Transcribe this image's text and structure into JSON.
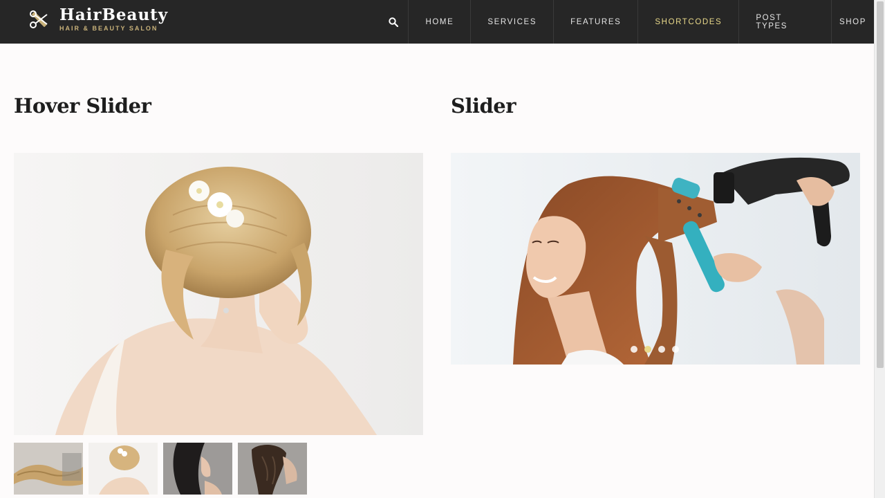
{
  "brand": {
    "title": "HairBeauty",
    "subtitle": "HAIR & BEAUTY SALON",
    "icon": "scissors-comb-icon"
  },
  "nav": {
    "search_icon": "search-icon",
    "items": [
      {
        "label": "HOME",
        "active": false
      },
      {
        "label": "SERVICES",
        "active": false
      },
      {
        "label": "FEATURES",
        "active": false
      },
      {
        "label": "SHORTCODES",
        "active": true
      },
      {
        "label": "POST TYPES",
        "active": false
      },
      {
        "label": "SHOP",
        "active": false
      }
    ]
  },
  "sections": {
    "hover_slider_title": "Hover Slider",
    "slider_title": "Slider"
  },
  "slider": {
    "dot_count": 4,
    "active_dot": 2
  },
  "colors": {
    "header_bg": "#262626",
    "accent": "#e9d98a",
    "page_bg": "#fdfbfb"
  }
}
